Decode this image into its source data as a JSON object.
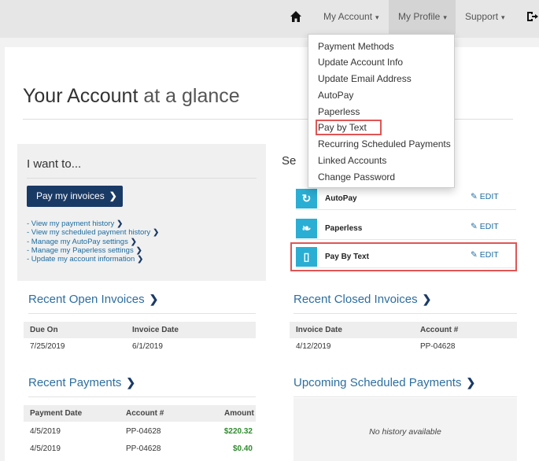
{
  "nav": {
    "my_account": "My Account",
    "my_profile": "My Profile",
    "support": "Support"
  },
  "dropdown": {
    "items": [
      "Payment Methods",
      "Update Account Info",
      "Update Email Address",
      "AutoPay",
      "Paperless",
      "Pay by Text",
      "Recurring Scheduled Payments",
      "Linked Accounts",
      "Change Password"
    ],
    "highlighted": "Pay by Text"
  },
  "title": {
    "main": "Your Account",
    "light": "at a glance"
  },
  "want": {
    "heading": "I want to...",
    "pay_button": "Pay my invoices",
    "links": [
      "- View my payment history",
      "- View my scheduled payment history",
      "- Manage my AutoPay settings",
      "- Manage my Paperless settings",
      "- Update my account information"
    ]
  },
  "services": {
    "heading_partial": "Se",
    "edit_label": "EDIT",
    "items": [
      {
        "label": "AutoPay",
        "icon": "refresh-icon"
      },
      {
        "label": "Paperless",
        "icon": "leaf-icon"
      },
      {
        "label": "Pay By Text",
        "icon": "phone-icon"
      }
    ]
  },
  "open_invoices": {
    "heading": "Recent Open Invoices",
    "columns": [
      "Due On",
      "Invoice Date"
    ],
    "rows": [
      [
        "7/25/2019",
        "6/1/2019"
      ]
    ]
  },
  "closed_invoices": {
    "heading": "Recent Closed Invoices",
    "columns": [
      "Invoice Date",
      "Account #"
    ],
    "rows": [
      [
        "4/12/2019",
        "PP-04628"
      ]
    ]
  },
  "payments": {
    "heading": "Recent Payments",
    "columns": [
      "Payment Date",
      "Account #",
      "Amount"
    ],
    "rows": [
      [
        "4/5/2019",
        "PP-04628",
        "$220.32"
      ],
      [
        "4/5/2019",
        "PP-04628",
        "$0.40"
      ]
    ]
  },
  "scheduled": {
    "heading": "Upcoming Scheduled Payments",
    "empty": "No history available"
  },
  "colors": {
    "navy": "#1a3a66",
    "accent_blue": "#2baed3",
    "link": "#1d6ca0",
    "highlight_red": "#e05555",
    "amount_green": "#2e8b2e"
  }
}
